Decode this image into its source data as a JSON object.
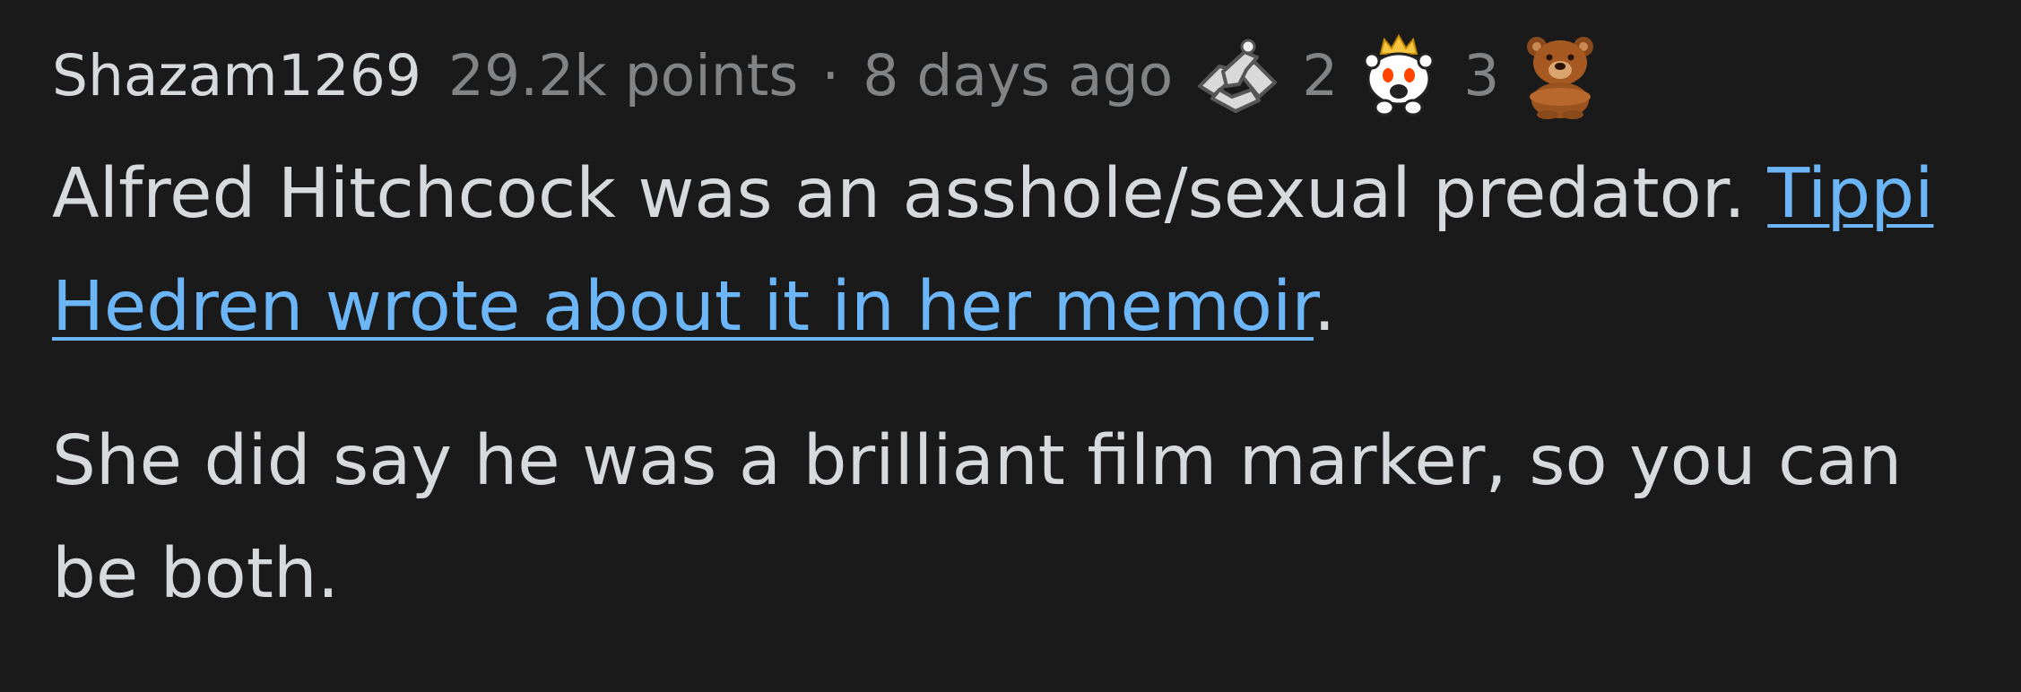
{
  "comment": {
    "author": "Shazam1269",
    "points": "29.2k points",
    "separator": "·",
    "age": "8 days ago",
    "awards": [
      {
        "icon": "handshake-award-icon",
        "count": "2"
      },
      {
        "icon": "wholesome-award-icon",
        "count": "3"
      },
      {
        "icon": "bear-award-icon",
        "count": ""
      }
    ],
    "body": {
      "p1_before": "Alfred Hitchcock was an asshole/sexual predator. ",
      "p1_link": "Tippi Hedren wrote about it in her memoir",
      "p1_after": ".",
      "p2": "She did say he was a brilliant film marker, so you can be both."
    }
  },
  "colors": {
    "background": "#1a1a1b",
    "text": "#d7dadc",
    "meta": "#818384",
    "link": "#6cb6f7"
  }
}
